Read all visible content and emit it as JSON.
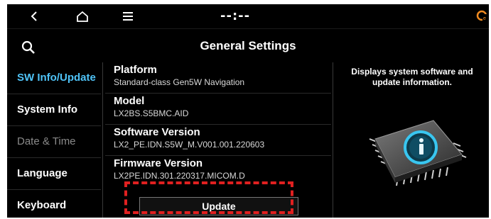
{
  "topbar": {
    "back_icon": "back-arrow-icon",
    "home_icon": "home-icon",
    "menu_icon": "menu-icon",
    "clock": "--:--",
    "status_icon": "gps-status-icon"
  },
  "header": {
    "title": "General Settings",
    "search_icon": "search-icon"
  },
  "sidebar": {
    "items": [
      {
        "label": "SW Info/Update",
        "state": "active"
      },
      {
        "label": "System Info",
        "state": "normal"
      },
      {
        "label": "Date & Time",
        "state": "disabled"
      },
      {
        "label": "Language",
        "state": "normal"
      },
      {
        "label": "Keyboard",
        "state": "normal"
      }
    ]
  },
  "content": {
    "items": [
      {
        "title": "Platform",
        "value": "Standard-class Gen5W Navigation"
      },
      {
        "title": "Model",
        "value": "LX2BS.S5BMC.AID"
      },
      {
        "title": "Software Version",
        "value": "LX2_PE.IDN.S5W_M.V001.001.220603"
      },
      {
        "title": "Firmware Version",
        "value": "LX2PE.IDN.301.220317.MICOM.D"
      }
    ],
    "update_label": "Update"
  },
  "description": "Displays system software and update information.",
  "illustration_icon": "info-chip-icon",
  "colors": {
    "background": "#000000",
    "accent": "#4fc3f7",
    "highlight": "#e02020"
  }
}
